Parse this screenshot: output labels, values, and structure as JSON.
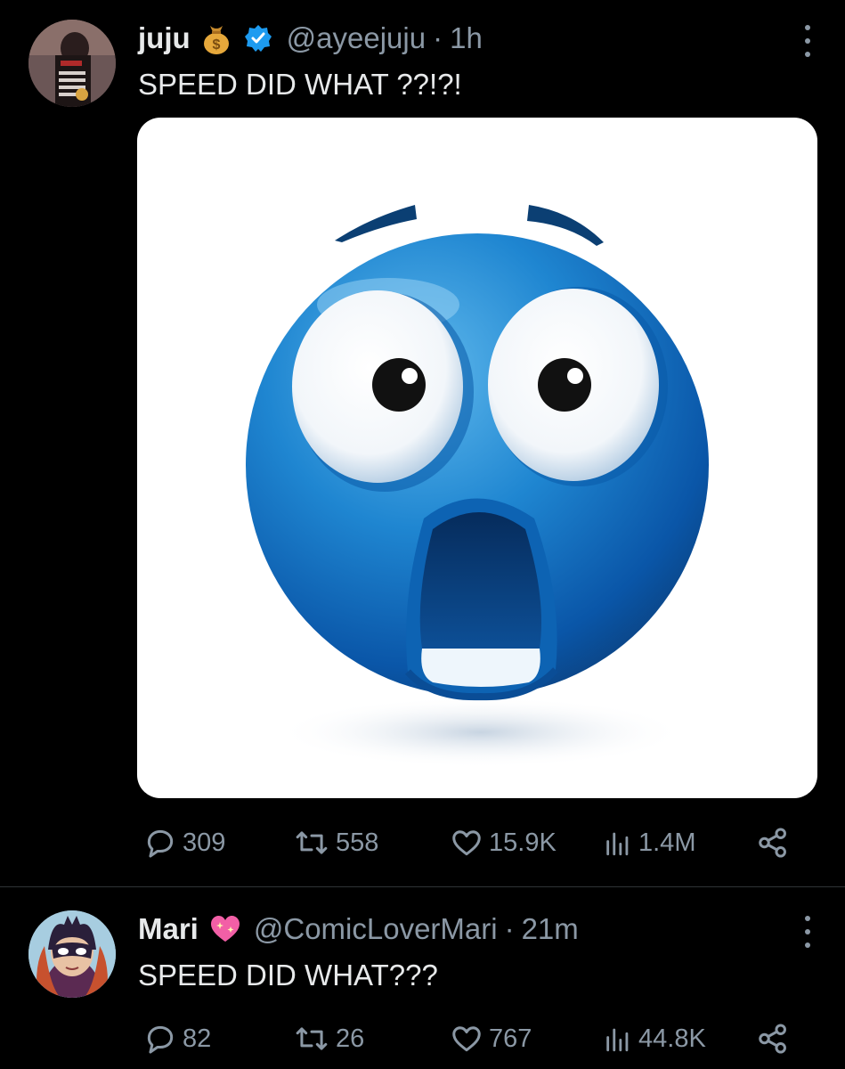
{
  "tweets": [
    {
      "name": "juju",
      "name_badge": "money-bag",
      "verified": true,
      "handle": "@ayeejuju",
      "separator": "·",
      "time": "1h",
      "text": "SPEED DID WHAT ??!?!",
      "media": "shocked-blue-emoji-image",
      "stats": {
        "replies": "309",
        "reposts": "558",
        "likes": "15.9K",
        "views": "1.4M"
      }
    },
    {
      "name": "Mari",
      "name_badge": "sparkling-heart",
      "verified": false,
      "handle": "@ComicLoverMari",
      "separator": "·",
      "time": "21m",
      "text": "SPEED DID WHAT???",
      "stats": {
        "replies": "82",
        "reposts": "26",
        "likes": "767",
        "views": "44.8K"
      }
    }
  ],
  "colors": {
    "background": "#000000",
    "text": "#e7e9ea",
    "muted": "#8b98a5",
    "verified": "#1d9bf0",
    "divider": "#2f3336"
  }
}
